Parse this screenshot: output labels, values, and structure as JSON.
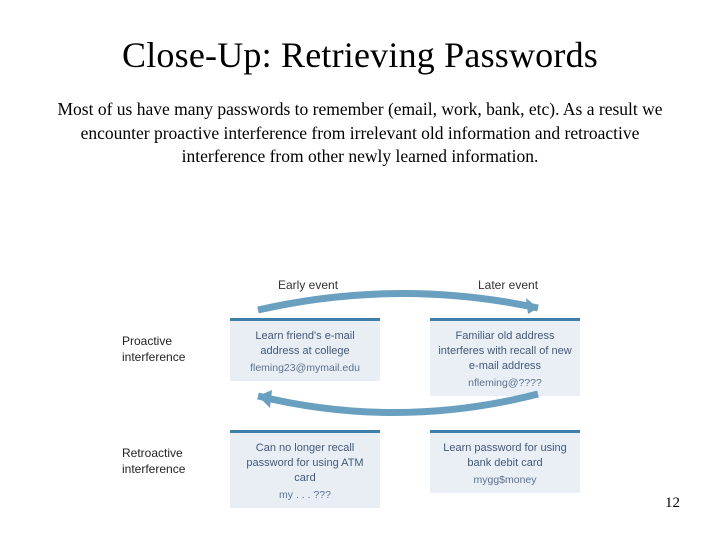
{
  "title": "Close-Up: Retrieving Passwords",
  "body": "Most of us have many passwords to remember (email, work, bank, etc). As a result we encounter proactive interference from irrelevant old information and retroactive interference from other newly learned information.",
  "diagram": {
    "col_early": "Early event",
    "col_later": "Later event",
    "row_proactive": "Proactive interference",
    "row_retroactive": "Retroactive interference",
    "boxes": {
      "top_left": {
        "main": "Learn friend's e-mail address at college",
        "sub": "fleming23@mymail.edu"
      },
      "top_right": {
        "main": "Familiar old address interferes with recall of new e-mail address",
        "sub": "nfleming@????"
      },
      "bottom_left": {
        "main": "Can no longer recall password for using ATM card",
        "sub": "my . . . ???"
      },
      "bottom_right": {
        "main": "Learn password for using bank debit card",
        "sub": "mygg$money"
      }
    }
  },
  "page_number": "12"
}
